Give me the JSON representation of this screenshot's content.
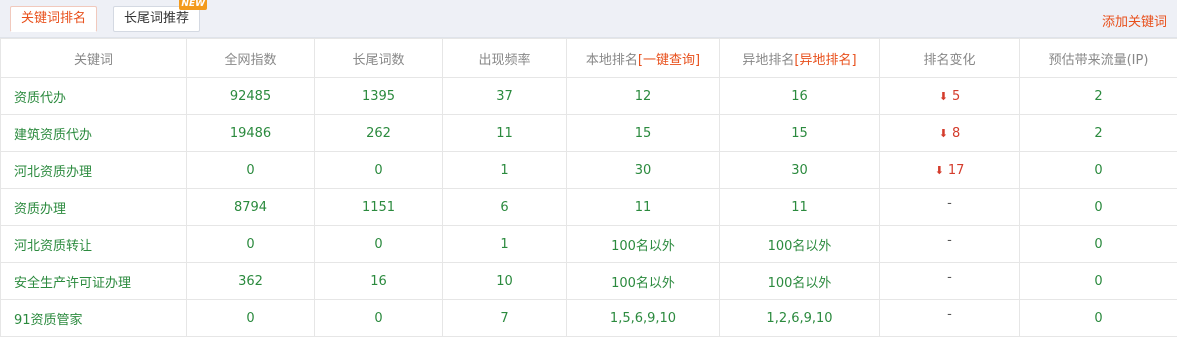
{
  "tabs": [
    {
      "label": "关键词排名",
      "active": true
    },
    {
      "label": "长尾词推荐",
      "badge": "NEW"
    }
  ],
  "add_keyword_label": "添加关键词",
  "columns": {
    "keyword": "关键词",
    "index": "全网指数",
    "longtail": "长尾词数",
    "freq": "出现频率",
    "local": "本地排名",
    "local_link": "[一键查询]",
    "remote": "异地排名",
    "remote_link": "[异地排名]",
    "change": "排名变化",
    "traffic": "预估带来流量(IP)"
  },
  "rows": [
    {
      "keyword": "资质代办",
      "index": "92485",
      "longtail": "1395",
      "freq": "37",
      "local": "12",
      "remote": "16",
      "change": "5",
      "change_dir": "down",
      "traffic": "2"
    },
    {
      "keyword": "建筑资质代办",
      "index": "19486",
      "longtail": "262",
      "freq": "11",
      "local": "15",
      "remote": "15",
      "change": "8",
      "change_dir": "down",
      "traffic": "2"
    },
    {
      "keyword": "河北资质办理",
      "index": "0",
      "longtail": "0",
      "freq": "1",
      "local": "30",
      "remote": "30",
      "change": "17",
      "change_dir": "down",
      "traffic": "0"
    },
    {
      "keyword": "资质办理",
      "index": "8794",
      "longtail": "1151",
      "freq": "6",
      "local": "11",
      "remote": "11",
      "change": "-",
      "change_dir": "none",
      "traffic": "0"
    },
    {
      "keyword": "河北资质转让",
      "index": "0",
      "longtail": "0",
      "freq": "1",
      "local": "100名以外",
      "remote": "100名以外",
      "change": "-",
      "change_dir": "none",
      "traffic": "0"
    },
    {
      "keyword": "安全生产许可证办理",
      "index": "362",
      "longtail": "16",
      "freq": "10",
      "local": "100名以外",
      "remote": "100名以外",
      "change": "-",
      "change_dir": "none",
      "traffic": "0"
    },
    {
      "keyword": "91资质管家",
      "index": "0",
      "longtail": "0",
      "freq": "7",
      "local": "1,5,6,9,10",
      "remote": "1,2,6,9,10",
      "change": "-",
      "change_dir": "none",
      "traffic": "0"
    }
  ],
  "colors": {
    "accent": "#e8501c",
    "value": "#2b8a3e",
    "down": "#d43c2c"
  }
}
